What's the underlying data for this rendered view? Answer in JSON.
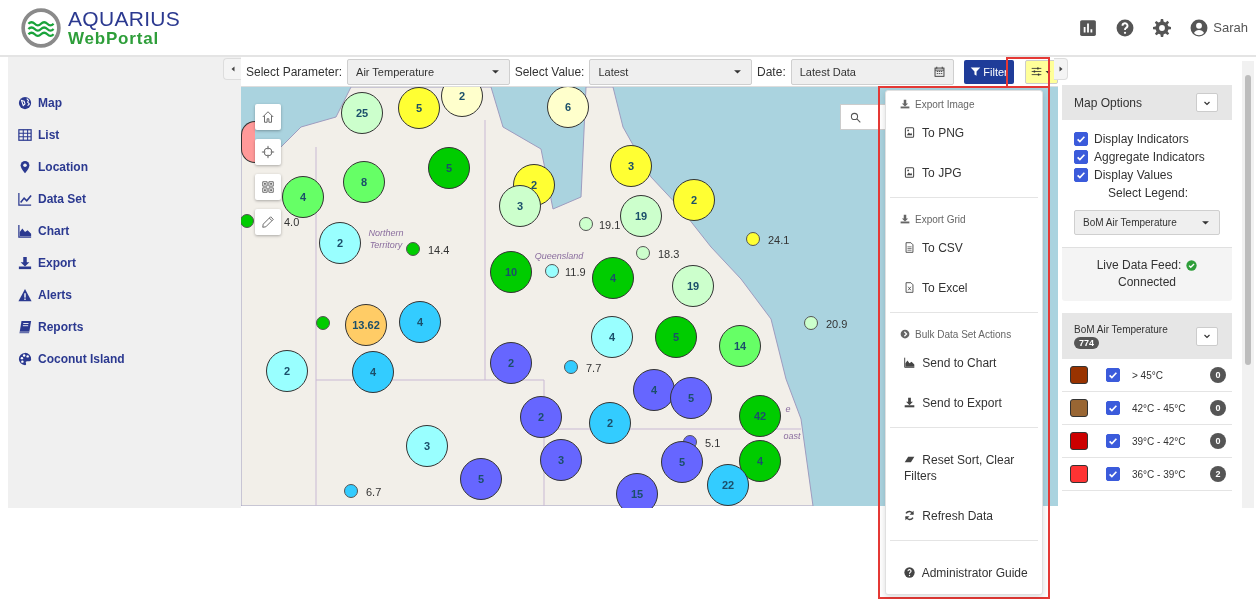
{
  "header": {
    "logo_title": "AQUARIUS",
    "logo_subtitle": "WebPortal",
    "user": "Sarah"
  },
  "sidebar": {
    "items": [
      {
        "label": "Map"
      },
      {
        "label": "List"
      },
      {
        "label": "Location"
      },
      {
        "label": "Data Set"
      },
      {
        "label": "Chart"
      },
      {
        "label": "Export"
      },
      {
        "label": "Alerts"
      },
      {
        "label": "Reports"
      },
      {
        "label": "Coconut Island"
      }
    ]
  },
  "toolbar": {
    "parameter_label": "Select Parameter:",
    "parameter_value": "Air Temperature",
    "value_label": "Select Value:",
    "value_value": "Latest",
    "date_label": "Date:",
    "date_value": "Latest Data",
    "filter_button": "Filter"
  },
  "map": {
    "region_labels": [
      "Northern Territory",
      "Queensland",
      "e",
      "oast"
    ],
    "clusters": [
      {
        "count": "25",
        "color": "#ccffcc"
      },
      {
        "count": "5",
        "color": "#ffff33"
      },
      {
        "count": "2",
        "color": "#ffffcc"
      },
      {
        "count": "6",
        "color": "#ffffcc"
      },
      {
        "color": "#ff9999"
      },
      {
        "count": "8",
        "color": "#66ff66"
      },
      {
        "count": "4",
        "color": "#66ff66"
      },
      {
        "count": "5",
        "color": "#00cc00"
      },
      {
        "count": "2",
        "color": "#ffff33"
      },
      {
        "count": "3",
        "color": "#ccffcc"
      },
      {
        "count": "3",
        "color": "#ffff33"
      },
      {
        "count": "2",
        "color": "#ffff33"
      },
      {
        "count": "19",
        "color": "#ccffcc"
      },
      {
        "count": "19",
        "color": "#ccffcc"
      },
      {
        "count": "2",
        "color": "#99ffff"
      },
      {
        "count": "10",
        "color": "#00cc00"
      },
      {
        "count": "4",
        "color": "#00cc00"
      },
      {
        "count": "13.62",
        "color": "#ffcc66"
      },
      {
        "count": "4",
        "color": "#33ccff"
      },
      {
        "count": "2",
        "color": "#99ffff"
      },
      {
        "count": "4",
        "color": "#33ccff"
      },
      {
        "count": "4",
        "color": "#99ffff"
      },
      {
        "count": "5",
        "color": "#00cc00"
      },
      {
        "count": "14",
        "color": "#66ff66"
      },
      {
        "count": "2",
        "color": "#6666ff"
      },
      {
        "count": "4",
        "color": "#6666ff"
      },
      {
        "count": "5",
        "color": "#6666ff"
      },
      {
        "count": "42",
        "color": "#00cc00"
      },
      {
        "count": "2",
        "color": "#6666ff"
      },
      {
        "count": "2",
        "color": "#33ccff"
      },
      {
        "count": "3",
        "color": "#99ffff"
      },
      {
        "count": "3",
        "color": "#6666ff"
      },
      {
        "count": "5",
        "color": "#6666ff"
      },
      {
        "count": "4",
        "color": "#00cc00"
      },
      {
        "count": "5",
        "color": "#6666ff"
      },
      {
        "count": "22",
        "color": "#33ccff"
      },
      {
        "count": "15",
        "color": "#6666ff"
      }
    ],
    "points": [
      {
        "value": "4.0",
        "color": "#00cc00"
      },
      {
        "value": "14.4",
        "color": "#00cc00"
      },
      {
        "value": "19.1",
        "color": "#ccffcc"
      },
      {
        "value": "18.3",
        "color": "#ccffcc"
      },
      {
        "value": "24.1",
        "color": "#ffff33"
      },
      {
        "value": "11.9",
        "color": "#99ffff"
      },
      {
        "color": "#00cc00"
      },
      {
        "value": "7.7",
        "color": "#33ccff"
      },
      {
        "value": "20.9",
        "color": "#ccffcc"
      },
      {
        "value": "5.1",
        "color": "#6666ff"
      },
      {
        "value": "6.7",
        "color": "#33ccff"
      }
    ]
  },
  "menu": {
    "sections": [
      {
        "title": "Export Image",
        "items": [
          "To PNG",
          "To JPG"
        ]
      },
      {
        "title": "Export Grid",
        "items": [
          "To CSV",
          "To Excel"
        ]
      },
      {
        "title": "Bulk Data Set Actions",
        "items": [
          "Send to Chart",
          "Send to Export"
        ]
      },
      {
        "items": [
          "Reset Sort, Clear Filters",
          "Refresh Data"
        ]
      },
      {
        "items": [
          "Administrator Guide"
        ]
      }
    ]
  },
  "map_options": {
    "title": "Map Options",
    "options": [
      {
        "label": "Display Indicators",
        "checked": true
      },
      {
        "label": "Aggregate Indicators",
        "checked": true
      },
      {
        "label": "Display Values",
        "checked": true
      }
    ],
    "legend_label": "Select Legend:",
    "legend_value": "BoM Air Temperature",
    "feed_label": "Live Data Feed:",
    "feed_status": "Connected"
  },
  "legend": {
    "title": "BoM Air Temperature",
    "total": "774",
    "rows": [
      {
        "label": "> 45°C",
        "color": "#993300",
        "checked": true,
        "count": "0"
      },
      {
        "label": "42°C - 45°C",
        "color": "#996633",
        "checked": true,
        "count": "0"
      },
      {
        "label": "39°C - 42°C",
        "color": "#cc0000",
        "checked": true,
        "count": "0"
      },
      {
        "label": "36°C - 39°C",
        "color": "#ff3333",
        "checked": true,
        "count": "2"
      }
    ]
  }
}
